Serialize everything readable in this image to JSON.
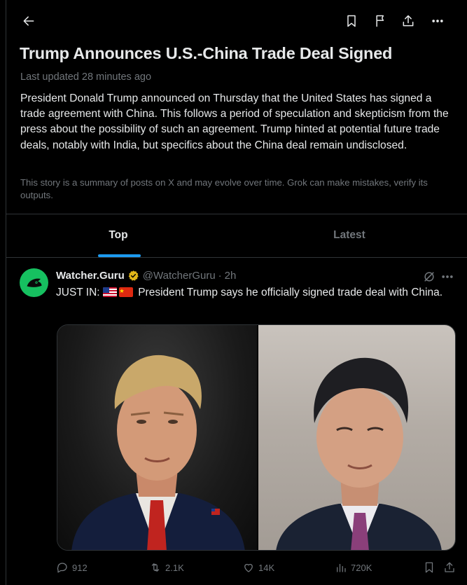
{
  "header": {
    "back_icon": "arrow-left-icon",
    "bookmark_icon": "bookmark-icon",
    "flag_icon": "report-flag-icon",
    "share_icon": "share-icon",
    "more_icon": "more-icon"
  },
  "story": {
    "title": "Trump Announces U.S.-China Trade Deal Signed",
    "updated": "Last updated 28 minutes ago",
    "summary": "President Donald Trump announced on Thursday that the United States has signed a trade agreement with China. This follows a period of speculation and skepticism from the press about the possibility of such an agreement. Trump hinted at potential future trade deals, notably with India, but specifics about the China deal remain undisclosed.",
    "disclaimer": "This story is a summary of posts on X and may evolve over time. Grok can make mistakes, verify its outputs."
  },
  "tabs": [
    {
      "label": "Top",
      "active": true
    },
    {
      "label": "Latest",
      "active": false
    }
  ],
  "post": {
    "author_name": "Watcher.Guru",
    "handle": "@WatcherGuru",
    "separator": "·",
    "time": "2h",
    "text_prefix": "JUST IN:",
    "text_body": "President Trump says he officially signed trade deal with China.",
    "flags": [
      "us-flag",
      "china-flag"
    ],
    "media": [
      "photo-trump",
      "photo-xi"
    ],
    "stats": {
      "replies": "912",
      "reposts": "2.1K",
      "likes": "14K",
      "views": "720K"
    }
  },
  "colors": {
    "background": "#000000",
    "text_primary": "#e7e9ea",
    "text_secondary": "#71767b",
    "accent": "#1d9bf0",
    "avatar_green": "#16c060",
    "verified_gold": "#e2b719",
    "border": "#2f3336"
  }
}
